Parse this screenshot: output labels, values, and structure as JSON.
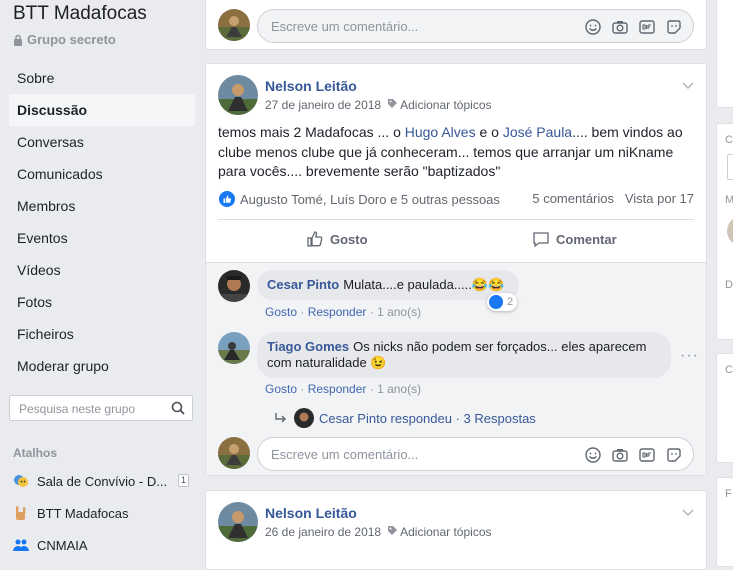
{
  "group": {
    "title": "BTT Madafocas",
    "privacy": "Grupo secreto"
  },
  "nav": [
    {
      "label": "Sobre",
      "active": false
    },
    {
      "label": "Discussão",
      "active": true
    },
    {
      "label": "Conversas",
      "active": false
    },
    {
      "label": "Comunicados",
      "active": false
    },
    {
      "label": "Membros",
      "active": false
    },
    {
      "label": "Eventos",
      "active": false
    },
    {
      "label": "Vídeos",
      "active": false
    },
    {
      "label": "Fotos",
      "active": false
    },
    {
      "label": "Ficheiros",
      "active": false
    },
    {
      "label": "Moderar grupo",
      "active": false
    }
  ],
  "search": {
    "placeholder": "Pesquisa neste grupo"
  },
  "shortcuts": {
    "title": "Atalhos",
    "items": [
      {
        "label": "Sala de Convívio - D...",
        "badge": "1",
        "icon": "masks-icon"
      },
      {
        "label": "BTT Madafocas",
        "icon": "rock-hand-icon"
      },
      {
        "label": "CNMAIA",
        "icon": "group-icon"
      }
    ]
  },
  "composer": {
    "placeholder": "Escreve um comentário..."
  },
  "post": {
    "author": "Nelson Leitão",
    "date": "27 de janeiro de 2018",
    "add_topics": "Adicionar tópicos",
    "text_1": "temos mais 2 Madafocas ... o ",
    "mention_1": "Hugo Alves",
    "text_2": " e o ",
    "mention_2": "José Paula",
    "text_3": ".... bem vindos ao clube menos clube que já conheceram... temos que arranjar um niKname para vocês.... brevemente serão \"baptizados\"",
    "reactions_text": "Augusto Tomé, Luís Doro e 5 outras pessoas",
    "comments_count": "5 comentários",
    "views": "Vista por 17",
    "like_label": "Gosto",
    "comment_label": "Comentar"
  },
  "comments": [
    {
      "author": "Cesar Pinto",
      "text": "Mulata....e paulada.....",
      "emoji": "😂😂",
      "like": "Gosto",
      "reply": "Responder",
      "time": "1 ano(s)",
      "reaction_count": "2"
    },
    {
      "author": "Tiago Gomes",
      "text": "Os nicks não podem ser forçados... eles aparecem com naturalidade",
      "emoji": "😉",
      "like": "Gosto",
      "reply": "Responder",
      "time": "1 ano(s)"
    }
  ],
  "reply_summary": {
    "author_replied": "Cesar Pinto respondeu",
    "replies": "3 Respostas"
  },
  "second_post": {
    "author": "Nelson Leitão",
    "date": "26 de janeiro de 2018",
    "add_topics": "Adicionar tópicos"
  },
  "right_column_letters": [
    "C",
    "M",
    "D",
    "C",
    "F"
  ],
  "colors": {
    "link": "#365899",
    "accent": "#1877f2",
    "background": "#e9ebee"
  }
}
